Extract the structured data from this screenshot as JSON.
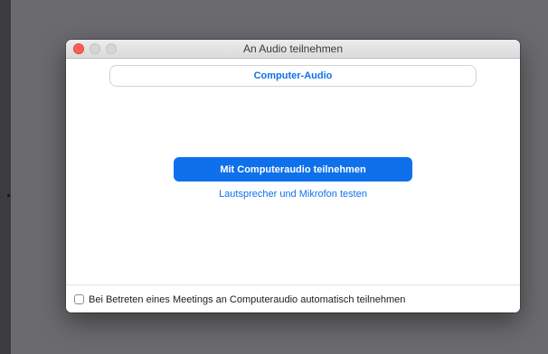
{
  "window": {
    "title": "An Audio teilnehmen"
  },
  "tabs": {
    "active_label": "Computer-Audio"
  },
  "main": {
    "join_button_label": "Mit Computeraudio teilnehmen",
    "test_link_label": "Lautsprecher und Mikrofon testen"
  },
  "footer": {
    "checkbox_label": "Bei Betreten eines Meetings an Computeraudio automatisch teilnehmen",
    "checkbox_checked": false
  },
  "colors": {
    "accent": "#0e71eb",
    "close_button": "#ff5f57",
    "backdrop": "#6b6b6f"
  }
}
